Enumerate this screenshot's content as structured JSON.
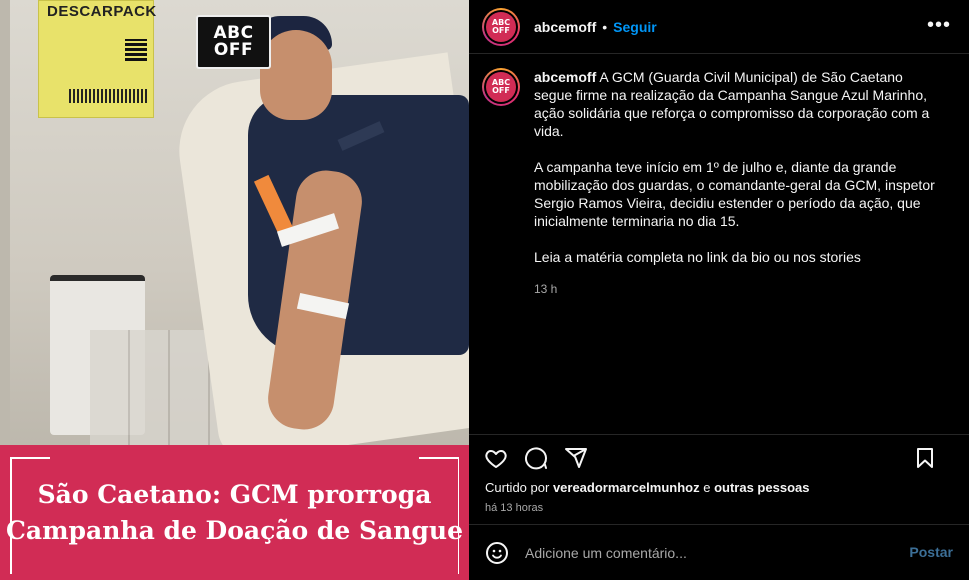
{
  "media": {
    "poster_title": "DESCARPACK",
    "logo_line1": "ABC",
    "logo_line2": "OFF",
    "banner_line1": "São Caetano: GCM prorroga",
    "banner_line2": "Campanha de Doação de Sangue"
  },
  "header": {
    "avatar_line1": "ABC",
    "avatar_line2": "OFF",
    "username": "abcemoff",
    "separator": "•",
    "follow_label": "Seguir",
    "more_label": "•••"
  },
  "caption": {
    "username": "abcemoff",
    "paragraph1": "A GCM (Guarda Civil Municipal) de São Caetano segue firme na realização da Campanha Sangue Azul Marinho, ação solidária que reforça o compromisso da corporação com a vida.",
    "paragraph2": "A campanha teve início em 1º de julho e, diante da grande mobilização dos guardas, o comandante-geral da GCM, inspetor Sergio Ramos Vieira, decidiu estender o período da ação, que inicialmente terminaria no dia 15.",
    "paragraph3": "Leia a matéria completa no link da bio ou nos stories",
    "time_ago": "13 h"
  },
  "actions": {
    "icons": [
      "heart-icon",
      "comment-icon",
      "share-icon",
      "bookmark-icon"
    ]
  },
  "likes": {
    "prefix": "Curtido por",
    "user": "vereadormarcelmunhoz",
    "connector": "e",
    "others": "outras pessoas"
  },
  "post_time": "há 13 horas",
  "comment": {
    "placeholder": "Adicione um comentário...",
    "post_label": "Postar"
  },
  "colors": {
    "accent": "#0095f6",
    "banner": "#d12c55",
    "background": "#000000",
    "muted_text": "#a8a8a8"
  }
}
